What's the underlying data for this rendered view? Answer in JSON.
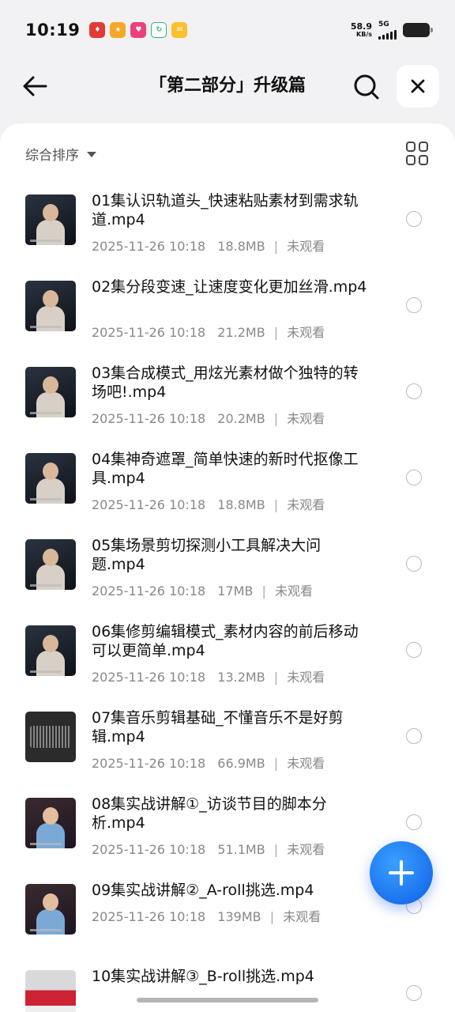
{
  "status_bar": {
    "time": "10:19",
    "net_speed_value": "58.9",
    "net_speed_unit": "KB/s",
    "network_type": "5G"
  },
  "header": {
    "title": "「第二部分」升级篇"
  },
  "sort": {
    "label": "综合排序"
  },
  "files": [
    {
      "name": "01集认识轨道头_快速粘贴素材到需求轨道.mp4",
      "date": "2025-11-26 10:18",
      "size": "18.8MB",
      "status": "未观看",
      "thumb": "person"
    },
    {
      "name": "02集分段变速_让速度变化更加丝滑.mp4",
      "date": "2025-11-26 10:18",
      "size": "21.2MB",
      "status": "未观看",
      "thumb": "person"
    },
    {
      "name": "03集合成模式_用炫光素材做个独特的转场吧!.mp4",
      "date": "2025-11-26 10:18",
      "size": "20.2MB",
      "status": "未观看",
      "thumb": "person"
    },
    {
      "name": "04集神奇遮罩_简单快速的新时代抠像工具.mp4",
      "date": "2025-11-26 10:18",
      "size": "18.8MB",
      "status": "未观看",
      "thumb": "person"
    },
    {
      "name": "05集场景剪切探测小工具解决大问题.mp4",
      "date": "2025-11-26 10:18",
      "size": "17MB",
      "status": "未观看",
      "thumb": "person"
    },
    {
      "name": "06集修剪编辑模式_素材内容的前后移动可以更简单.mp4",
      "date": "2025-11-26 10:18",
      "size": "13.2MB",
      "status": "未观看",
      "thumb": "person"
    },
    {
      "name": "07集音乐剪辑基础_不懂音乐不是好剪辑.mp4",
      "date": "2025-11-26 10:18",
      "size": "66.9MB",
      "status": "未观看",
      "thumb": "wave"
    },
    {
      "name": "08集实战讲解①_访谈节目的脚本分析.mp4",
      "date": "2025-11-26 10:18",
      "size": "51.1MB",
      "status": "未观看",
      "thumb": "bright"
    },
    {
      "name": "09集实战讲解②_A-roll挑选.mp4",
      "date": "2025-11-26 10:18",
      "size": "139MB",
      "status": "未观看",
      "thumb": "bright"
    },
    {
      "name": "10集实战讲解③_B-roll挑选.mp4",
      "date": "",
      "size": "",
      "status": "",
      "thumb": "car"
    }
  ],
  "colors": {
    "accent": "#1a73f0",
    "background": "#f2f2f4",
    "meta_text": "#888888"
  }
}
